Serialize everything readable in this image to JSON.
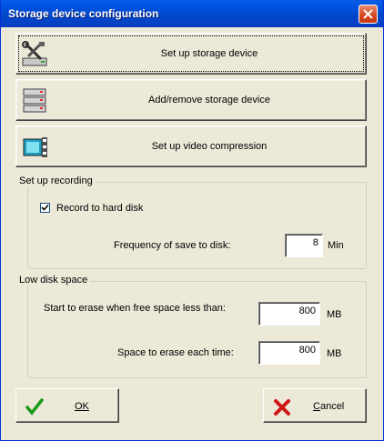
{
  "window": {
    "title": "Storage device configuration"
  },
  "buttons": {
    "setup_storage": "Set up storage device",
    "add_remove_storage": "Add/remove storage device",
    "setup_video": "Set up video compression"
  },
  "recording": {
    "legend": "Set up recording",
    "record_label": "Record to hard disk",
    "record_checked": true,
    "freq_label": "Frequency of save to disk:",
    "freq_value": "8",
    "freq_unit": "Min"
  },
  "lowdisk": {
    "legend": "Low disk space",
    "start_label": "Start to erase when free space less than:",
    "start_value": "800",
    "start_unit": "MB",
    "each_label": "Space to erase each time:",
    "each_value": "800",
    "each_unit": "MB"
  },
  "footer": {
    "ok_label": "OK",
    "cancel_prefix": "C",
    "cancel_rest": "ancel"
  },
  "icons": {
    "close": "close-icon",
    "setup_storage": "tools-icon",
    "add_remove": "drive-stack-icon",
    "video": "film-icon",
    "ok": "checkmark-icon",
    "cancel": "x-icon"
  }
}
